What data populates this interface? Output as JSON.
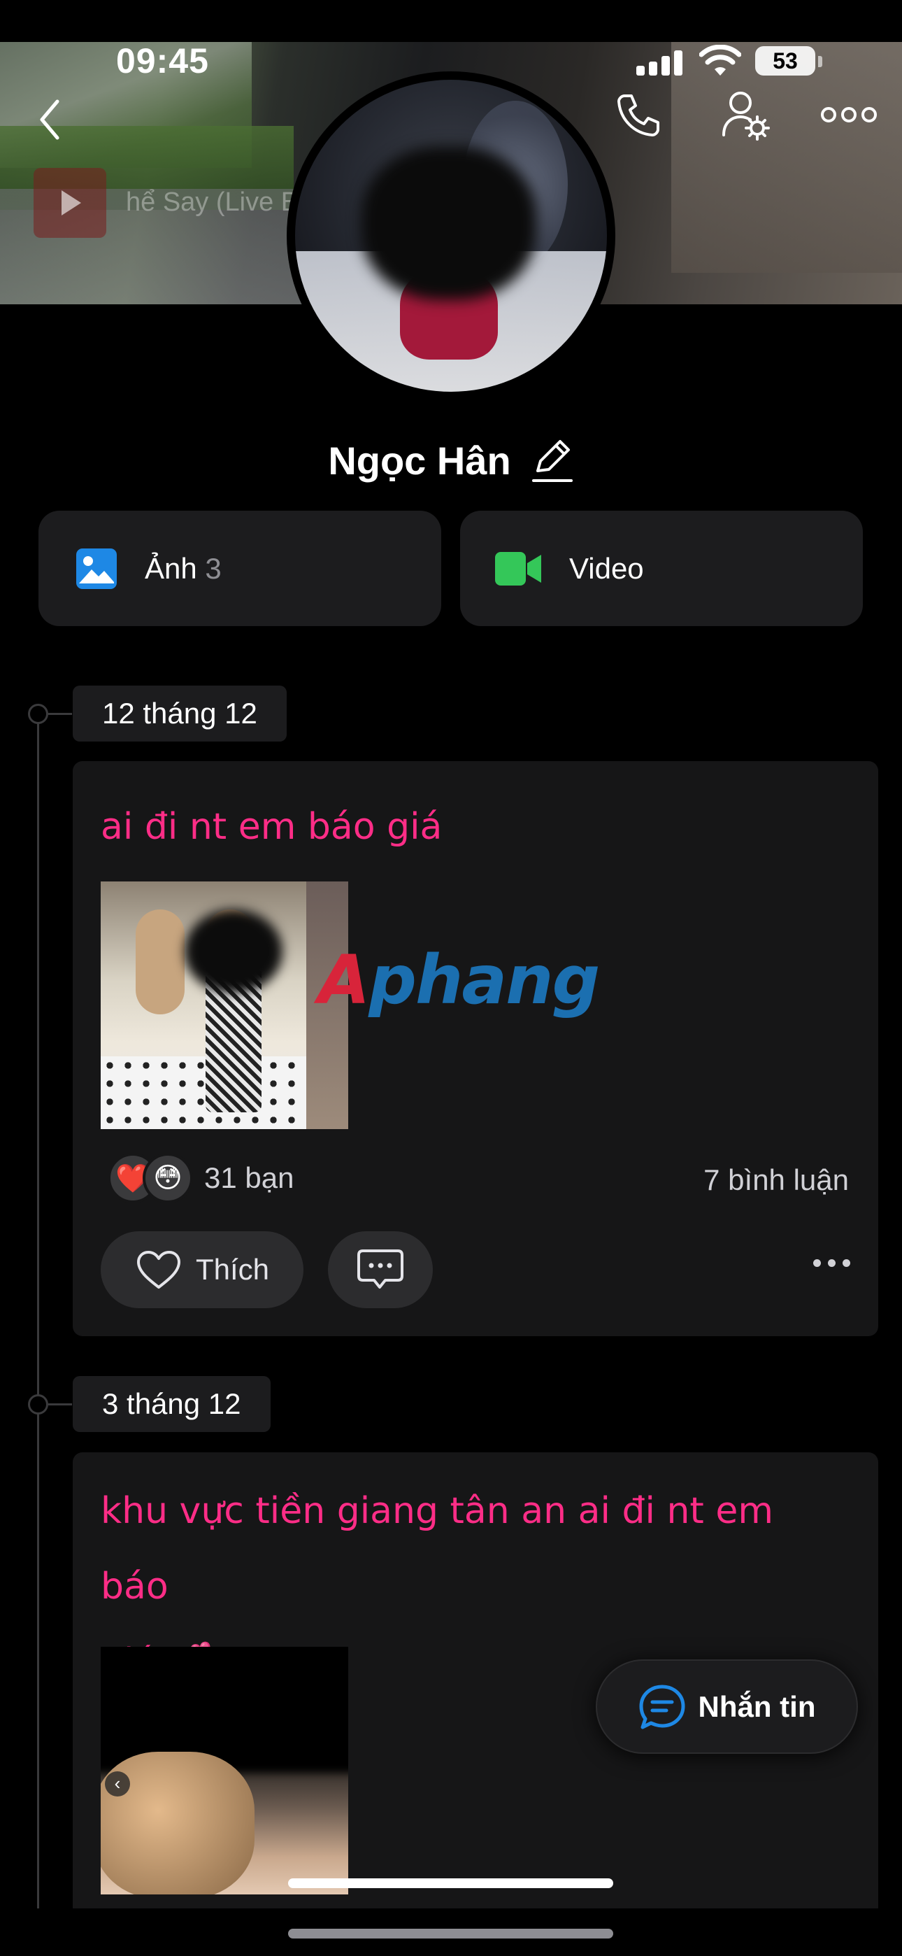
{
  "status_bar": {
    "time": "09:45",
    "battery": "53"
  },
  "cover": {
    "ghost_video_title": "hể Say (Live Ban"
  },
  "profile": {
    "name": "Ngọc Hân"
  },
  "albums": {
    "photos_label": "Ảnh",
    "photos_count": "3",
    "video_label": "Video"
  },
  "posts": [
    {
      "date": "12 tháng 12",
      "text": "ai đi nt em báo giá",
      "reactions": [
        "❤️",
        "😳"
      ],
      "reaction_count": "31 bạn",
      "comments": "7 bình luận",
      "like_label": "Thích"
    },
    {
      "date": "3 tháng 12",
      "text_line1": "khu vực tiền giang tân an ai đi nt em báo",
      "text_line2": "giá 💕"
    }
  ],
  "watermark": {
    "first": "A",
    "rest": "phang"
  },
  "fab": {
    "label": "Nhắn tin"
  },
  "colors": {
    "accent_pink": "#ff2d87",
    "blue": "#1e88e5",
    "green": "#34c759"
  }
}
